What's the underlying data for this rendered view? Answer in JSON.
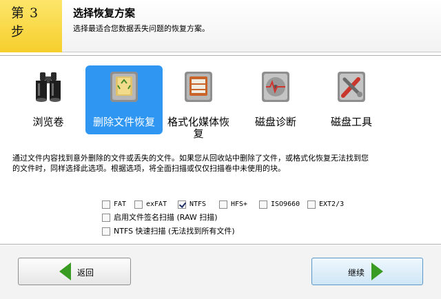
{
  "step": {
    "label": "第 3 步"
  },
  "header": {
    "title": "选择恢复方案",
    "subtitle": "选择最适合您数据丢失问题的恢复方案。"
  },
  "options": [
    {
      "label": "浏览卷",
      "icon": "binoculars-icon",
      "selected": false
    },
    {
      "label": "删除文件恢复",
      "icon": "recycle-bin-disk-icon",
      "selected": true
    },
    {
      "label": "格式化媒体恢复",
      "icon": "format-disk-icon",
      "selected": false
    },
    {
      "label": "磁盘诊断",
      "icon": "disk-diagnostic-icon",
      "selected": false
    },
    {
      "label": "磁盘工具",
      "icon": "disk-tools-icon",
      "selected": false
    }
  ],
  "description": {
    "line1": "通过文件内容找到意外删除的文件或丢失的文件。如果您从回收站中删除了文件，或格式化恢复无法找到您",
    "line2": "的文件时，同样选择此选项。根据选项，将全面扫描或仅仅扫描卷中未使用的块。"
  },
  "filesystems": [
    {
      "label": "FAT",
      "checked": false
    },
    {
      "label": "exFAT",
      "checked": false
    },
    {
      "label": "NTFS",
      "checked": true
    },
    {
      "label": "HFS+",
      "checked": false
    },
    {
      "label": "ISO9660",
      "checked": false
    },
    {
      "label": "EXT2/3",
      "checked": false
    }
  ],
  "scan_options": [
    {
      "label": "启用文件签名扫描 (RAW 扫描)",
      "checked": false
    },
    {
      "label": "NTFS 快速扫描 (无法找到所有文件)",
      "checked": false
    }
  ],
  "buttons": {
    "back": "返回",
    "next": "继续"
  },
  "colors": {
    "step_badge": "#f6cf2c",
    "selected_option": "#2f96f2",
    "arrow": "#3a9b22"
  }
}
